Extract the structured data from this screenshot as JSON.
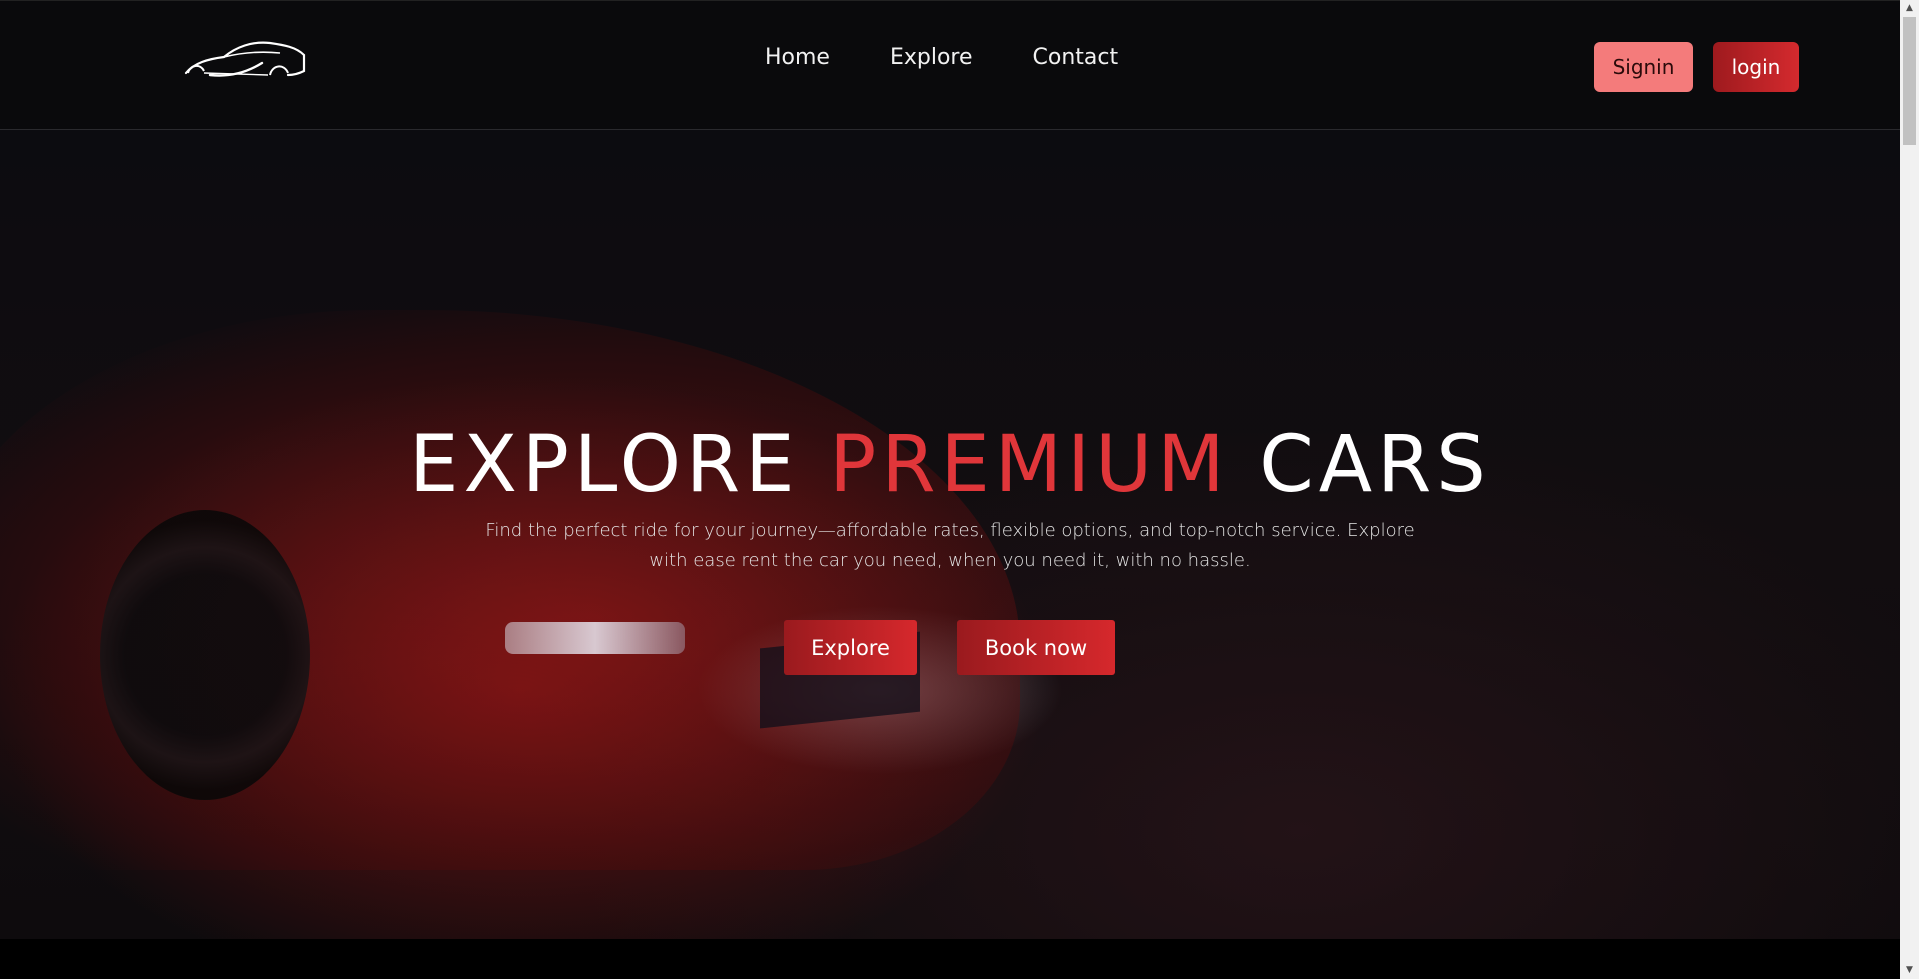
{
  "navbar": {
    "logo_icon": "sports-car-outline-logo",
    "links": [
      {
        "label": "Home"
      },
      {
        "label": "Explore"
      },
      {
        "label": "Contact"
      }
    ],
    "signin_label": "Signin",
    "login_label": "login"
  },
  "hero": {
    "title_part1": "EXPLORE ",
    "title_accent": "PREMIUM",
    "title_part2": " CARS",
    "subtitle": "Find the perfect ride for your journey—affordable rates, flexible options, and top-notch service. Explore with ease rent the car you need, when you need it, with no hassle.",
    "explore_label": "Explore",
    "book_label": "Book now",
    "background_image": "red-sports-car-night"
  },
  "colors": {
    "accent": "#e0363a",
    "button_gradient_start": "#9a1a1e",
    "button_gradient_end": "#d6282c",
    "signin_bg": "#f47b7b",
    "navbar_bg": "#0a0a0c"
  },
  "scrollbar": {
    "up_icon": "arrow-up-icon",
    "down_icon": "arrow-down-icon"
  }
}
